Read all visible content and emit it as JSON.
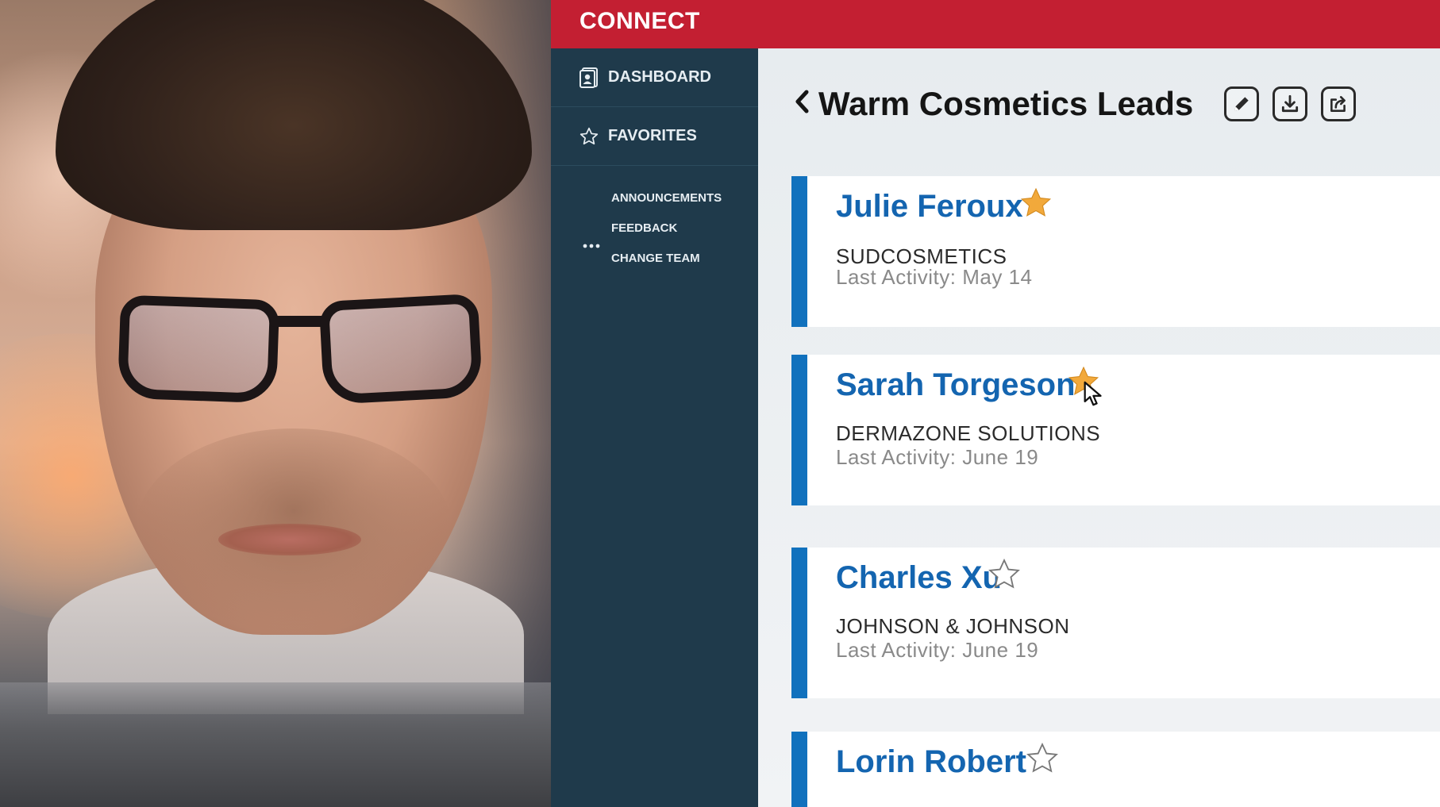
{
  "app": {
    "brand": "CONNECT"
  },
  "sidebar": {
    "main_items": [
      {
        "label": "DASHBOARD",
        "icon": "contact-card-icon"
      },
      {
        "label": "FAVORITES",
        "icon": "star-outline-icon"
      }
    ],
    "more_icon": "more-dots-icon",
    "sub_items": [
      "ANNOUNCEMENTS",
      "FEEDBACK",
      "CHANGE TEAM"
    ]
  },
  "header": {
    "back_icon": "chevron-left-icon",
    "title": "Warm Cosmetics Leads",
    "tools": [
      "edit-icon",
      "download-icon",
      "share-icon"
    ]
  },
  "leads": [
    {
      "name": "Julie Feroux",
      "company": "SUDCOSMETICS",
      "activity": "Last Activity: May 14",
      "favorite": true
    },
    {
      "name": "Sarah Torgeson",
      "company": "DERMAZONE SOLUTIONS",
      "activity": "Last Activity: June 19",
      "favorite": true
    },
    {
      "name": "Charles Xu",
      "company": "JOHNSON & JOHNSON",
      "activity": "Last Activity: June 19",
      "favorite": false
    },
    {
      "name": "Lorin Robert",
      "favorite": false
    }
  ],
  "colors": {
    "brand_red": "#c31f32",
    "sidebar": "#1f3a4b",
    "accent_blue": "#1171bd",
    "star_gold": "#f2a93b"
  }
}
